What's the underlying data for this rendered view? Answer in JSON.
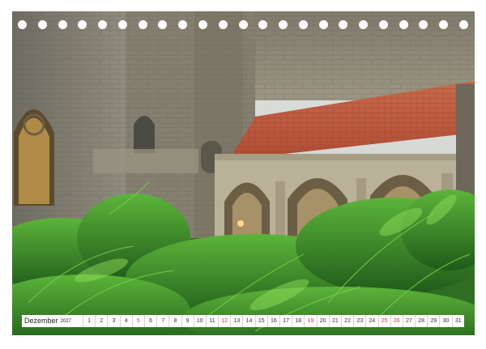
{
  "calendar": {
    "month": "Dezember",
    "year": "2027",
    "days": [
      "1",
      "2",
      "3",
      "4",
      "5",
      "6",
      "7",
      "8",
      "9",
      "10",
      "11",
      "12",
      "13",
      "14",
      "15",
      "16",
      "17",
      "18",
      "19",
      "20",
      "21",
      "22",
      "23",
      "24",
      "25",
      "26",
      "27",
      "28",
      "29",
      "30",
      "31"
    ],
    "highlight_days": [
      "5",
      "12",
      "19",
      "25",
      "26"
    ],
    "highlight_color": "#d23c2a"
  },
  "photo": {
    "alt_icon": "cloister-courtyard-photo"
  },
  "colors": {
    "roof": "#c4573b",
    "stone": "#9a9482",
    "fern": "#3f9a2a"
  }
}
